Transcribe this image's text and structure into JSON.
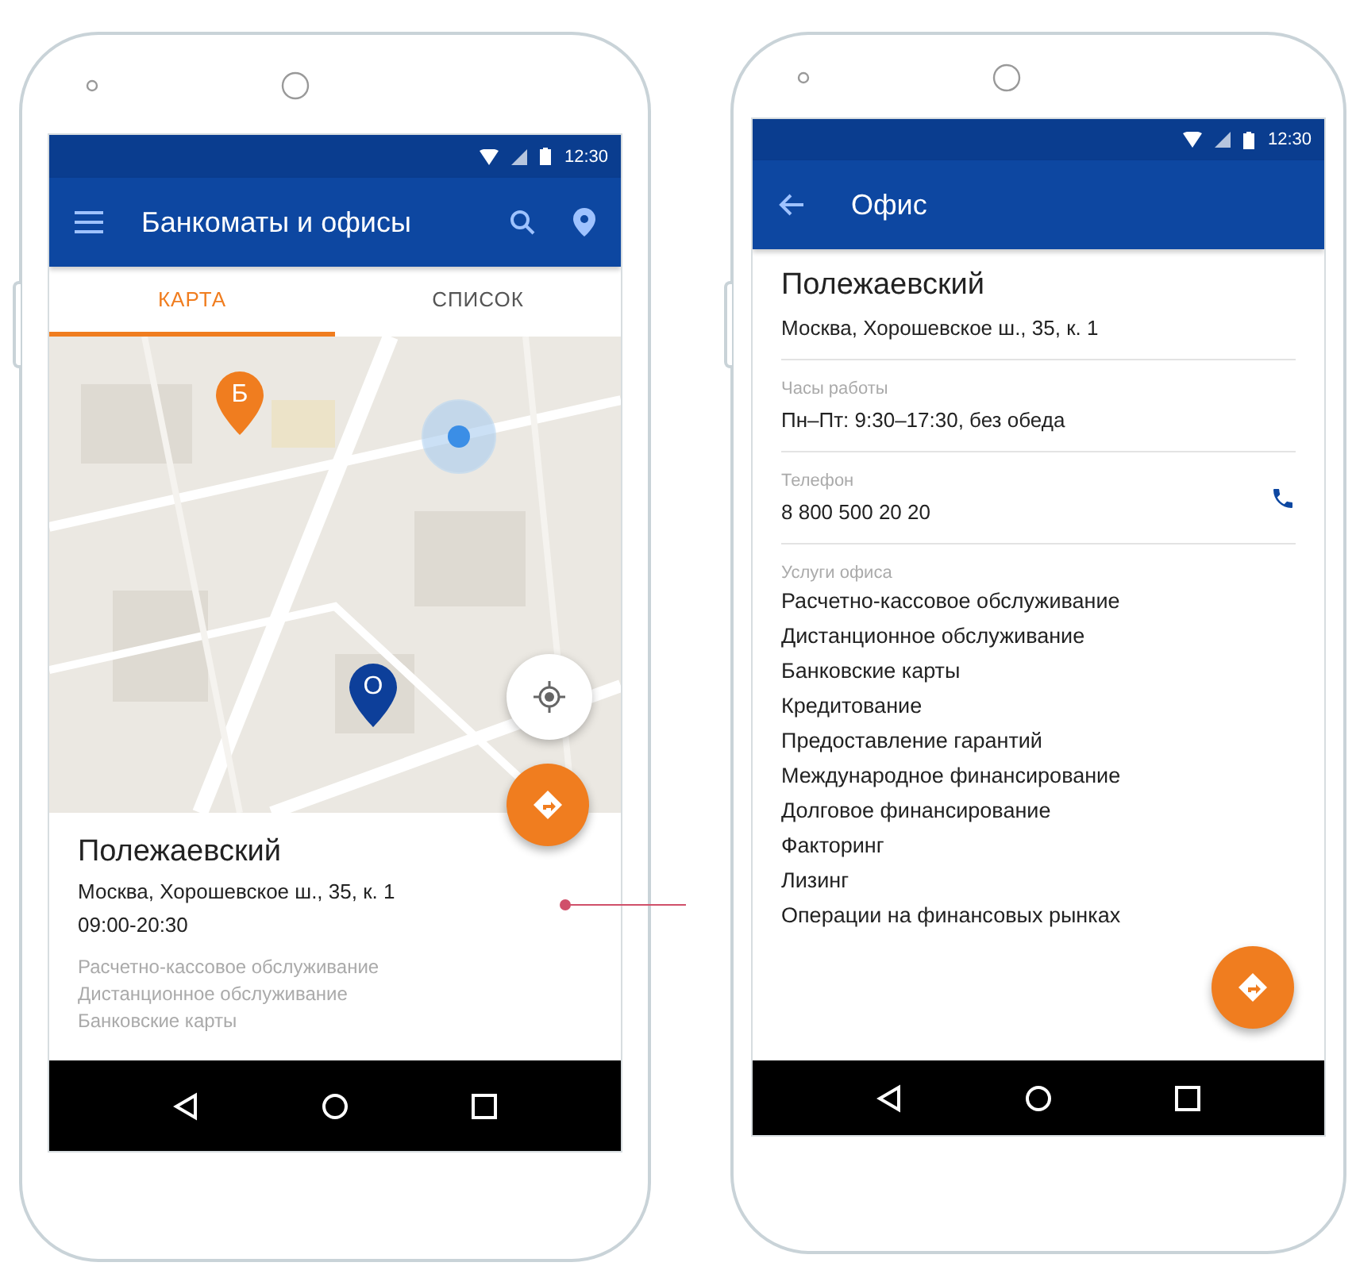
{
  "map_screen": {
    "status_bar": {
      "time": "12:30"
    },
    "app_bar": {
      "title": "Банкоматы и офисы"
    },
    "tabs": [
      {
        "label": "КАРТА",
        "selected": true
      },
      {
        "label": "СПИСОК",
        "selected": false
      }
    ],
    "map": {
      "kind": "picture",
      "pins": [
        {
          "label": "Б",
          "color": "#f07d1f"
        },
        {
          "label": "О",
          "color": "#0d3f9a"
        }
      ]
    },
    "card": {
      "name": "Полежаевский",
      "address": "Москва, Хорошевское ш., 35, к. 1",
      "hours": "09:00-20:30",
      "services": [
        "Расчетно-кассовое обслуживание",
        "Дистанционное обслуживание",
        "Банковские карты"
      ]
    }
  },
  "office_screen": {
    "status_bar": {
      "time": "12:30"
    },
    "app_bar": {
      "title": "Офис"
    },
    "name": "Полежаевский",
    "address": "Москва, Хорошевское ш., 35, к. 1",
    "hours": {
      "label": "Часы работы",
      "value": "Пн–Пт: 9:30–17:30, без обеда"
    },
    "phone": {
      "label": "Телефон",
      "value": "8 800 500 20 20"
    },
    "services": {
      "label": "Услуги офиса",
      "items": [
        "Расчетно-кассовое обслуживание",
        "Дистанционное обслуживание",
        "Банковские карты",
        "Кредитование",
        "Предоставление гарантий",
        "Международное финансирование",
        "Долговое финансирование",
        "Факторинг",
        "Лизинг",
        "Операции на финансовых рынках"
      ]
    }
  }
}
